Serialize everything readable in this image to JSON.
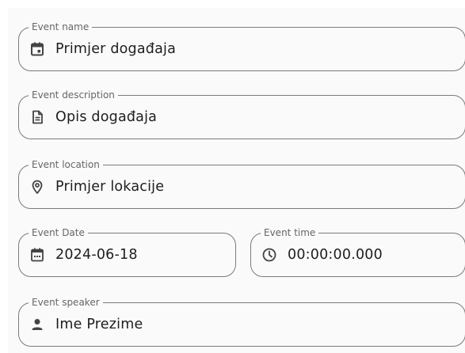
{
  "form": {
    "event_name": {
      "label": "Event name",
      "value": "Primjer događaja",
      "icon": "calendar-event-icon"
    },
    "event_description": {
      "label": "Event description",
      "value": "Opis događaja",
      "icon": "document-icon"
    },
    "event_location": {
      "label": "Event location",
      "value": "Primjer lokacije",
      "icon": "location-pin-icon"
    },
    "event_date": {
      "label": "Event Date",
      "value": "2024-06-18",
      "icon": "calendar-icon"
    },
    "event_time": {
      "label": "Event time",
      "value": "00:00:00.000",
      "icon": "clock-icon"
    },
    "event_speaker": {
      "label": "Event speaker",
      "value": "Ime Prezime",
      "icon": "person-icon"
    }
  },
  "colors": {
    "border": "#7a7a7a",
    "label": "#666666",
    "text": "#1e1e1e",
    "icon": "#444444",
    "background": "#fafafa"
  }
}
